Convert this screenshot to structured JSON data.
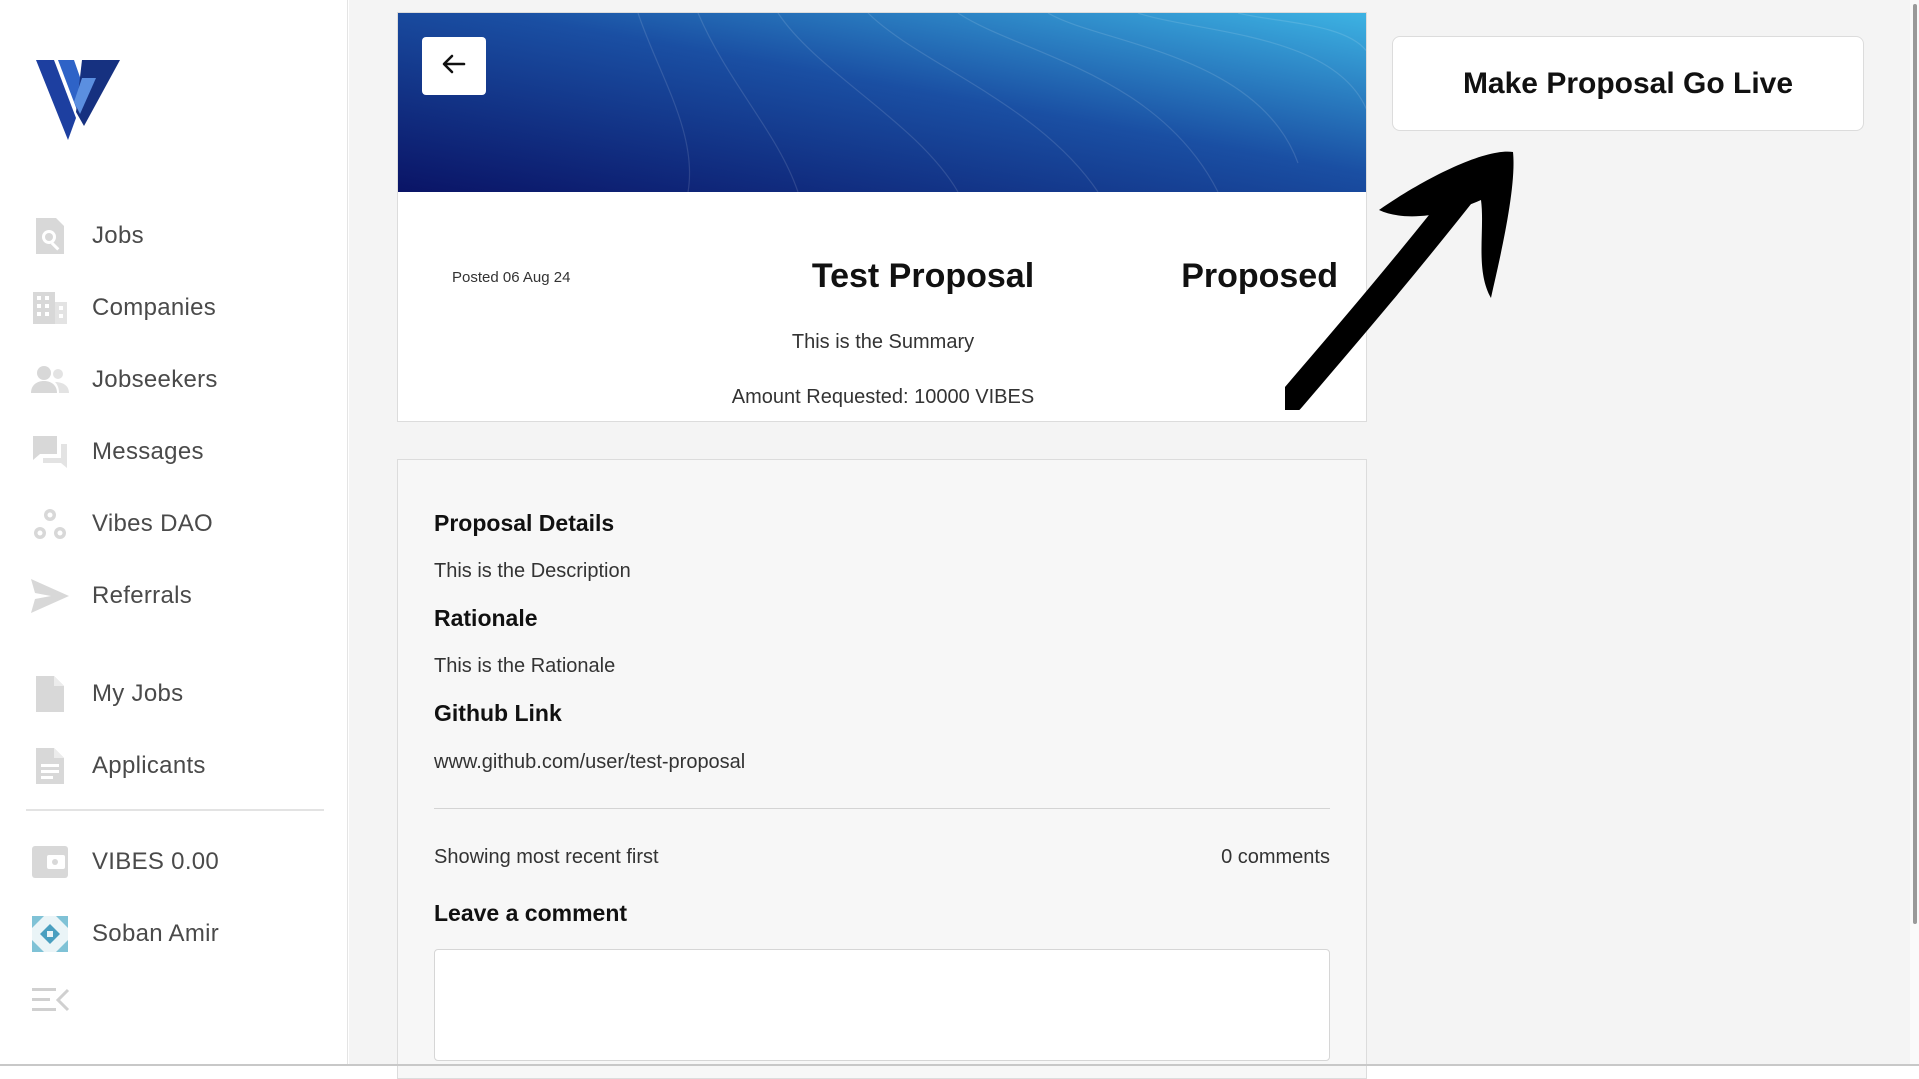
{
  "sidebar": {
    "logo_icon": "vibes-logo-icon",
    "nav_items": [
      {
        "label": "Jobs",
        "icon": "job-search-icon"
      },
      {
        "label": "Companies",
        "icon": "building-icon"
      },
      {
        "label": "Jobseekers",
        "icon": "users-icon"
      },
      {
        "label": "Messages",
        "icon": "chat-icon"
      },
      {
        "label": "Vibes DAO",
        "icon": "dao-icon"
      },
      {
        "label": "Referrals",
        "icon": "send-icon"
      },
      {
        "label": "My Jobs",
        "icon": "document-icon"
      },
      {
        "label": "Applicants",
        "icon": "document-lines-icon"
      }
    ],
    "wallet_label": "VIBES 0.00",
    "user_name": "Soban Amir",
    "collapse_icon": "collapse-menu-icon"
  },
  "proposal": {
    "posted": "Posted 06 Aug 24",
    "title": "Test Proposal",
    "status": "Proposed",
    "summary": "This is the Summary",
    "amount": "Amount Requested: 10000 VIBES"
  },
  "details": {
    "details_heading": "Proposal Details",
    "description": "This is the Description",
    "rationale_heading": "Rationale",
    "rationale": "This is the Rationale",
    "github_heading": "Github Link",
    "github_link": "www.github.com/user/test-proposal",
    "showing": "Showing most recent first",
    "comments_count": "0 comments",
    "leave_comment": "Leave a comment",
    "comment_value": ""
  },
  "actions": {
    "make_live": "Make Proposal Go Live",
    "back_icon": "arrow-left-icon"
  },
  "colors": {
    "banner_start": "#0a1466",
    "banner_mid": "#1a4fa3",
    "banner_end": "#3db3e3",
    "logo_primary": "#1d3fa0",
    "nav_icon": "#d8d8d8"
  }
}
